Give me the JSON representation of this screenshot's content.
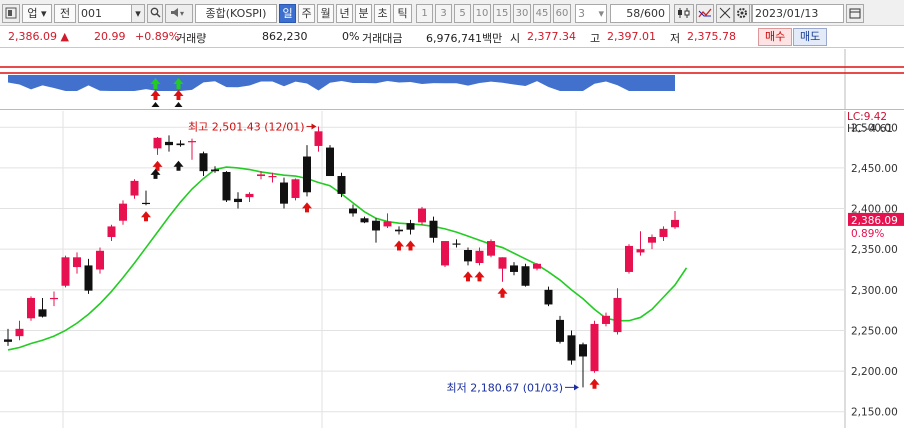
{
  "toolbar": {
    "market_select": "업",
    "type_label": "전",
    "code_value": "001",
    "name_value": "종합(KOSPI)",
    "periods": [
      "일",
      "주",
      "월",
      "년",
      "분",
      "초",
      "틱"
    ],
    "active_period": "일",
    "intervals": [
      "1",
      "3",
      "5",
      "10",
      "15",
      "30",
      "45",
      "60"
    ],
    "count_value": "3",
    "page_value": "58/600",
    "date_value": "2023/01/13"
  },
  "quote": {
    "price": "2,386.09",
    "change": "20.99",
    "change_pct": "+0.89%",
    "volume_label": "거래량",
    "volume_value": "862,230",
    "volume_pct": "0%",
    "amount_label": "거래대금",
    "amount_value": "6,976,741백만",
    "open_label": "시",
    "open_value": "2,377.34",
    "high_label": "고",
    "high_value": "2,397.01",
    "low_label": "저",
    "low_value": "2,375.78",
    "buy_label": "매수",
    "sell_label": "매도"
  },
  "chart_data": {
    "type": "candlestick",
    "ylim": [
      2130,
      2520
    ],
    "yticks": [
      "2,500.00",
      "2,450.00",
      "2,400.00",
      "2,350.00",
      "2,300.00",
      "2,250.00",
      "2,200.00",
      "2,150.00"
    ],
    "ytick_values": [
      2500,
      2450,
      2400,
      2350,
      2300,
      2250,
      2200,
      2150
    ],
    "candles": [
      {
        "o": 2239,
        "h": 2252,
        "l": 2231,
        "c": 2236
      },
      {
        "o": 2243,
        "h": 2262,
        "l": 2238,
        "c": 2252
      },
      {
        "o": 2265,
        "h": 2292,
        "l": 2262,
        "c": 2290
      },
      {
        "o": 2276,
        "h": 2290,
        "l": 2266,
        "c": 2267
      },
      {
        "o": 2290,
        "h": 2298,
        "l": 2280,
        "c": 2290
      },
      {
        "o": 2305,
        "h": 2342,
        "l": 2303,
        "c": 2340
      },
      {
        "o": 2328,
        "h": 2346,
        "l": 2320,
        "c": 2340
      },
      {
        "o": 2330,
        "h": 2338,
        "l": 2295,
        "c": 2299
      },
      {
        "o": 2325,
        "h": 2352,
        "l": 2320,
        "c": 2348
      },
      {
        "o": 2365,
        "h": 2380,
        "l": 2360,
        "c": 2378
      },
      {
        "o": 2385,
        "h": 2410,
        "l": 2380,
        "c": 2406
      },
      {
        "o": 2416,
        "h": 2436,
        "l": 2412,
        "c": 2434
      },
      {
        "o": 2407,
        "h": 2422,
        "l": 2404,
        "c": 2406
      },
      {
        "o": 2474,
        "h": 2488,
        "l": 2466,
        "c": 2487
      },
      {
        "o": 2482,
        "h": 2490,
        "l": 2470,
        "c": 2478
      },
      {
        "o": 2480,
        "h": 2484,
        "l": 2476,
        "c": 2478
      },
      {
        "o": 2482,
        "h": 2486,
        "l": 2460,
        "c": 2483
      },
      {
        "o": 2468,
        "h": 2470,
        "l": 2440,
        "c": 2446
      },
      {
        "o": 2448,
        "h": 2452,
        "l": 2444,
        "c": 2446
      },
      {
        "o": 2445,
        "h": 2446,
        "l": 2408,
        "c": 2410
      },
      {
        "o": 2412,
        "h": 2420,
        "l": 2400,
        "c": 2408
      },
      {
        "o": 2414,
        "h": 2420,
        "l": 2408,
        "c": 2418
      },
      {
        "o": 2440,
        "h": 2446,
        "l": 2436,
        "c": 2442
      },
      {
        "o": 2440,
        "h": 2444,
        "l": 2432,
        "c": 2440
      },
      {
        "o": 2432,
        "h": 2438,
        "l": 2400,
        "c": 2406
      },
      {
        "o": 2413,
        "h": 2437,
        "l": 2410,
        "c": 2436
      },
      {
        "o": 2464,
        "h": 2478,
        "l": 2415,
        "c": 2420
      },
      {
        "o": 2477,
        "h": 2501,
        "l": 2470,
        "c": 2495
      },
      {
        "o": 2475,
        "h": 2478,
        "l": 2440,
        "c": 2440
      },
      {
        "o": 2440,
        "h": 2444,
        "l": 2414,
        "c": 2418
      },
      {
        "o": 2400,
        "h": 2405,
        "l": 2390,
        "c": 2394
      },
      {
        "o": 2388,
        "h": 2390,
        "l": 2382,
        "c": 2383
      },
      {
        "o": 2385,
        "h": 2388,
        "l": 2358,
        "c": 2373
      },
      {
        "o": 2378,
        "h": 2394,
        "l": 2376,
        "c": 2384
      },
      {
        "o": 2374,
        "h": 2378,
        "l": 2368,
        "c": 2372
      },
      {
        "o": 2382,
        "h": 2386,
        "l": 2368,
        "c": 2374
      },
      {
        "o": 2383,
        "h": 2402,
        "l": 2380,
        "c": 2400
      },
      {
        "o": 2385,
        "h": 2390,
        "l": 2358,
        "c": 2364
      },
      {
        "o": 2330,
        "h": 2360,
        "l": 2328,
        "c": 2360
      },
      {
        "o": 2357,
        "h": 2362,
        "l": 2352,
        "c": 2356
      },
      {
        "o": 2349,
        "h": 2352,
        "l": 2330,
        "c": 2335
      },
      {
        "o": 2333,
        "h": 2352,
        "l": 2330,
        "c": 2348
      },
      {
        "o": 2342,
        "h": 2362,
        "l": 2340,
        "c": 2360
      },
      {
        "o": 2326,
        "h": 2340,
        "l": 2310,
        "c": 2340
      },
      {
        "o": 2330,
        "h": 2334,
        "l": 2318,
        "c": 2322
      },
      {
        "o": 2329,
        "h": 2332,
        "l": 2304,
        "c": 2305
      },
      {
        "o": 2326,
        "h": 2333,
        "l": 2324,
        "c": 2332
      },
      {
        "o": 2300,
        "h": 2304,
        "l": 2280,
        "c": 2282
      },
      {
        "o": 2263,
        "h": 2268,
        "l": 2234,
        "c": 2236
      },
      {
        "o": 2244,
        "h": 2250,
        "l": 2208,
        "c": 2213
      },
      {
        "o": 2233,
        "h": 2235,
        "l": 2180,
        "c": 2218
      },
      {
        "o": 2200,
        "h": 2262,
        "l": 2198,
        "c": 2258
      },
      {
        "o": 2258,
        "h": 2272,
        "l": 2255,
        "c": 2268
      },
      {
        "o": 2248,
        "h": 2302,
        "l": 2245,
        "c": 2290
      },
      {
        "o": 2322,
        "h": 2356,
        "l": 2320,
        "c": 2354
      },
      {
        "o": 2346,
        "h": 2372,
        "l": 2342,
        "c": 2350
      },
      {
        "o": 2358,
        "h": 2368,
        "l": 2350,
        "c": 2365
      },
      {
        "o": 2365,
        "h": 2378,
        "l": 2360,
        "c": 2375
      },
      {
        "o": 2377,
        "h": 2397,
        "l": 2375,
        "c": 2386
      }
    ],
    "ma": [
      2226,
      2229,
      2234,
      2238,
      2243,
      2250,
      2259,
      2270,
      2283,
      2298,
      2315,
      2333,
      2352,
      2371,
      2390,
      2408,
      2424,
      2437,
      2448,
      2451,
      2450,
      2448,
      2445,
      2443,
      2441,
      2440,
      2437,
      2432,
      2428,
      2418,
      2407,
      2396,
      2388,
      2384,
      2382,
      2381,
      2380,
      2378,
      2375,
      2371,
      2366,
      2361,
      2356,
      2352,
      2345,
      2338,
      2331,
      2322,
      2312,
      2300,
      2289,
      2276,
      2265,
      2262,
      2262,
      2266,
      2276,
      2291,
      2306,
      2327
    ],
    "high_annotation": "최고 2,501.43 (12/01)",
    "low_annotation": "최저 2,180.67 (01/03)",
    "lc_label": "LC:9.42",
    "hc_label": "HC:-4.61",
    "last_price_label": "2,386.09",
    "last_pct_label": "0.89%",
    "signals_up": [
      12,
      13,
      26,
      34,
      35,
      40,
      41,
      43,
      51
    ],
    "signals_black": [
      13,
      15
    ],
    "indicator_arrows": [
      13,
      15
    ]
  },
  "colors": {
    "up": "#e8114f",
    "down": "#111111",
    "ma": "#23cc23",
    "indicator_fill": "#2d62c8",
    "high_note": "#cc1111",
    "low_note": "#1a2fa0",
    "grid": "#e2e2e2"
  }
}
